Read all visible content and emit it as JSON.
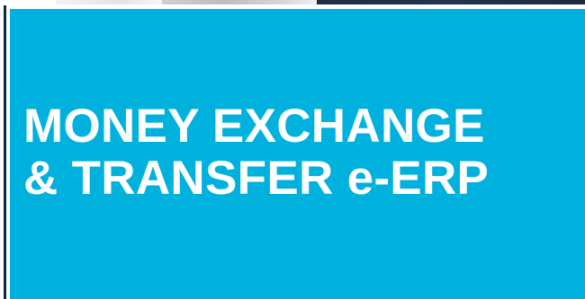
{
  "hero": {
    "title_line_1": "MONEY EXCHANGE",
    "title_line_2": "& TRANSFER e-ERP",
    "background_color": "#00b1de",
    "text_color": "#ffffff"
  }
}
